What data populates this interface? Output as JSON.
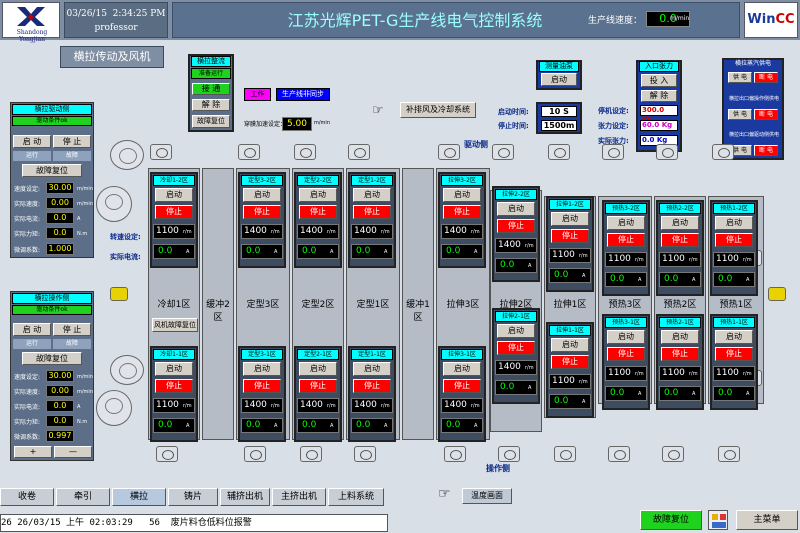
{
  "header": {
    "logo_text": "Shandong Yongjian",
    "date": "03/26/15",
    "time": "2:34:25 PM",
    "user": "professor",
    "title": "江苏光辉PET-G生产线电气控制系统",
    "speed_label": "生产线速度：",
    "speed_value": "0.0",
    "speed_unit": "m/min",
    "brand": "WinCC"
  },
  "page_title": "横拉传动及风机",
  "mode_panel": {
    "title": "横拉整流",
    "status": "准备运行",
    "ready": "接 通",
    "release": "解 除",
    "reset": "故障复位"
  },
  "work_badges": {
    "work": "工作",
    "line": "生产线非同步"
  },
  "through_speed": {
    "label": "穿膜加速设定：",
    "value": "5.00",
    "unit": "m/min"
  },
  "exhaust_button": "补排风及冷却系统",
  "drive_side": "驱动侧",
  "operate_side": "操作侧",
  "test_panel": {
    "title": "测量油泵",
    "start": "启动",
    "start_label": "启动时间:",
    "stop_label": "停止时间:",
    "start_value": "10",
    "start_unit": "S",
    "stop_value": "1500m"
  },
  "tension_panel": {
    "title": "入口张力",
    "button": "投 入",
    "release": "解 除",
    "stop_label": "停机设定:",
    "stop_value": "300.0",
    "stop_unit": "Kg",
    "set_label": "张力设定:",
    "set_value": "60.0",
    "set_unit": "Kg",
    "actual_label": "实际张力:",
    "actual_value": "0.0",
    "actual_unit": "Kg"
  },
  "cooling_panel": {
    "title": "横拉蒸汽供电",
    "row2": "横拉出口偏操作侧供电",
    "row3": "横拉出口偏驱动侧供电",
    "on": "供 电",
    "off": "断 电"
  },
  "left_drive": {
    "title": "横拉驱动侧",
    "status": "驱动条件ok",
    "start": "启 动",
    "stop": "停 止",
    "run": "运行",
    "fault": "故障",
    "reset": "故障复位",
    "rows": [
      {
        "label": "速度设定:",
        "value": "30.00",
        "unit": "m/min"
      },
      {
        "label": "实际速度:",
        "value": "0.00",
        "unit": "m/min"
      },
      {
        "label": "实际电流:",
        "value": "0.0",
        "unit": "A"
      },
      {
        "label": "实际力矩:",
        "value": "0.0",
        "unit": "N.m"
      }
    ],
    "coef_label": "微调系数:",
    "coef_value": "1.000"
  },
  "left_operate": {
    "title": "横拉操作侧",
    "status": "驱动条件ok",
    "start": "启 动",
    "stop": "停 止",
    "run": "运行",
    "fault": "故障",
    "reset": "故障复位",
    "rows": [
      {
        "label": "速度设定:",
        "value": "30.00",
        "unit": "m/min"
      },
      {
        "label": "实际速度:",
        "value": "0.00",
        "unit": "m/min"
      },
      {
        "label": "实际电流:",
        "value": "0.0",
        "unit": "A"
      },
      {
        "label": "实际力矩:",
        "value": "0.0",
        "unit": "N.m"
      }
    ],
    "coef_label": "微调系数:",
    "coef_value": "0.997",
    "plus": "+",
    "minus": "—"
  },
  "speed_labels": {
    "set": "转速设定:",
    "current": "实际电流:"
  },
  "zones": [
    {
      "name": "冷却1区"
    },
    {
      "name": "缓冲2区"
    },
    {
      "name": "定型3区"
    },
    {
      "name": "定型2区"
    },
    {
      "name": "定型1区"
    },
    {
      "name": "缓冲1区"
    },
    {
      "name": "拉伸3区"
    },
    {
      "name": "拉伸2区"
    },
    {
      "name": "拉伸1区"
    },
    {
      "name": "预热3区"
    },
    {
      "name": "预热2区"
    },
    {
      "name": "预热1区"
    }
  ],
  "fan_fault": "风机故障复位",
  "fan_units": {
    "start": "启动",
    "stop": "停止",
    "rpm_unit": "r/m",
    "amp_unit": "A",
    "top": [
      {
        "title": "冷却1-2区",
        "rpm": "1100",
        "amp": "0.0"
      },
      {
        "title": "定型3-2区",
        "rpm": "1400",
        "amp": "0.0"
      },
      {
        "title": "定型2-2区",
        "rpm": "1400",
        "amp": "0.0"
      },
      {
        "title": "定型1-2区",
        "rpm": "1400",
        "amp": "0.0"
      },
      {
        "title": "拉伸3-2区",
        "rpm": "1400",
        "amp": "0.0"
      },
      {
        "title": "拉伸2-2区",
        "rpm": "1400",
        "amp": "0.0"
      },
      {
        "title": "拉伸1-2区",
        "rpm": "1100",
        "amp": "0.0"
      },
      {
        "title": "预热3-2区",
        "rpm": "1100",
        "amp": "0.0"
      },
      {
        "title": "预热2-2区",
        "rpm": "1100",
        "amp": "0.0"
      },
      {
        "title": "预热1-2区",
        "rpm": "1100",
        "amp": "0.0"
      }
    ],
    "bottom": [
      {
        "title": "冷却1-1区",
        "rpm": "1100",
        "amp": "0.0"
      },
      {
        "title": "定型3-1区",
        "rpm": "1400",
        "amp": "0.0"
      },
      {
        "title": "定型2-1区",
        "rpm": "1400",
        "amp": "0.0"
      },
      {
        "title": "定型1-1区",
        "rpm": "1400",
        "amp": "0.0"
      },
      {
        "title": "拉伸3-1区",
        "rpm": "1400",
        "amp": "0.0"
      },
      {
        "title": "拉伸2-1区",
        "rpm": "1400",
        "amp": "0.0"
      },
      {
        "title": "拉伸1-1区",
        "rpm": "1100",
        "amp": "0.0"
      },
      {
        "title": "预热3-1区",
        "rpm": "1100",
        "amp": "0.0"
      },
      {
        "title": "预热2-1区",
        "rpm": "1100",
        "amp": "0.0"
      },
      {
        "title": "预热1-1区",
        "rpm": "1100",
        "amp": "0.0"
      }
    ]
  },
  "temp_button": "温度画面",
  "tabs": [
    "收卷",
    "牵引",
    "横拉",
    "铸片",
    "辅挤出机",
    "主挤出机",
    "上料系统"
  ],
  "active_tab": "横拉",
  "alarm": {
    "id": "26",
    "date": "26/03/15",
    "ampm": "上午",
    "time": "02:03:29",
    "code": "56",
    "text": "废片料仓低料位报警"
  },
  "fault_reset": "故障复位",
  "main_menu": "主菜单"
}
